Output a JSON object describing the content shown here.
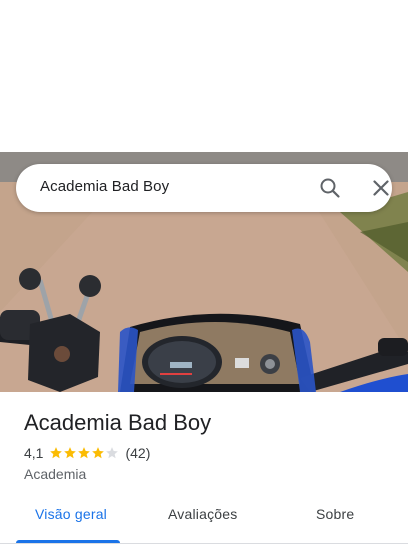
{
  "search": {
    "query": "Academia Bad Boy"
  },
  "place": {
    "title": "Academia Bad Boy",
    "rating": "4,1",
    "rating_value": 4.1,
    "review_count": "(42)",
    "category": "Academia"
  },
  "tabs": [
    {
      "label": "Visão geral",
      "active": true
    },
    {
      "label": "Avaliações",
      "active": false
    },
    {
      "label": "Sobre",
      "active": false
    }
  ],
  "colors": {
    "accent": "#1a73e8",
    "star": "#fbbc04",
    "star_empty": "#dadce0"
  },
  "icons": {
    "search": "search-icon",
    "close": "close-icon"
  }
}
